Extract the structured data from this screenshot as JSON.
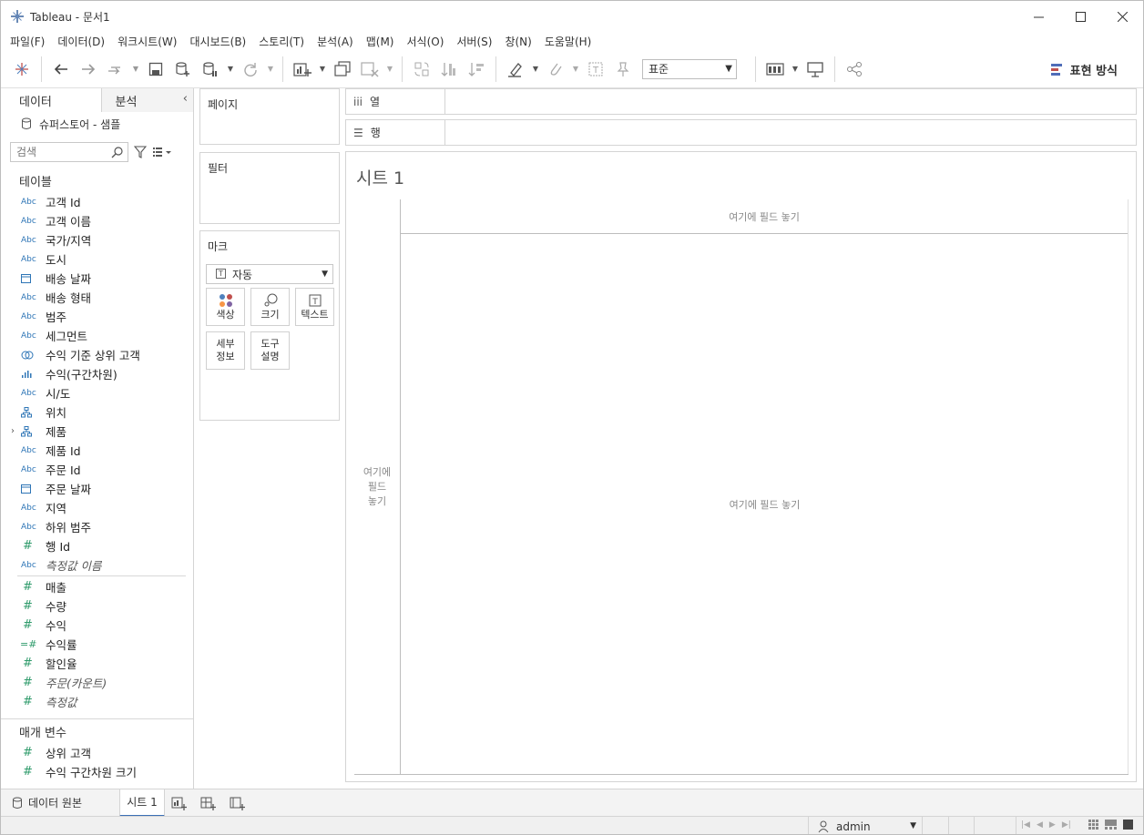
{
  "window": {
    "title": "Tableau - 문서1"
  },
  "menu": [
    "파일(F)",
    "데이터(D)",
    "워크시트(W)",
    "대시보드(B)",
    "스토리(T)",
    "분석(A)",
    "맵(M)",
    "서식(O)",
    "서버(S)",
    "창(N)",
    "도움말(H)"
  ],
  "toolbar": {
    "fit_select": "표준",
    "show_me_label": "표현 방식"
  },
  "data_pane": {
    "tab_data": "데이터",
    "tab_analytics": "분석",
    "datasource": "슈퍼스토어 - 샘플",
    "search_placeholder": "검색",
    "tables_title": "테이블",
    "dimensions": [
      {
        "icon": "Abc",
        "name": "고객 Id"
      },
      {
        "icon": "Abc",
        "name": "고객 이름"
      },
      {
        "icon": "Abc",
        "name": "국가/지역"
      },
      {
        "icon": "Abc",
        "name": "도시"
      },
      {
        "icon": "date",
        "name": "배송 날짜"
      },
      {
        "icon": "Abc",
        "name": "배송 형태"
      },
      {
        "icon": "Abc",
        "name": "범주"
      },
      {
        "icon": "Abc",
        "name": "세그먼트"
      },
      {
        "icon": "set",
        "name": "수익 기준 상위 고객"
      },
      {
        "icon": "bin",
        "name": "수익(구간차원)"
      },
      {
        "icon": "Abc",
        "name": "시/도"
      },
      {
        "icon": "hierarchy",
        "name": "위치"
      },
      {
        "icon": "hierarchy",
        "name": "제품",
        "expandable": true
      },
      {
        "icon": "Abc",
        "name": "제품 Id"
      },
      {
        "icon": "Abc",
        "name": "주문 Id"
      },
      {
        "icon": "date",
        "name": "주문 날짜"
      },
      {
        "icon": "Abc",
        "name": "지역"
      },
      {
        "icon": "Abc",
        "name": "하위 범주"
      },
      {
        "icon": "#",
        "name": "행 Id"
      },
      {
        "icon": "Abc",
        "name": "측정값 이름",
        "italic": true
      }
    ],
    "measures": [
      {
        "icon": "#",
        "name": "매출"
      },
      {
        "icon": "#",
        "name": "수량"
      },
      {
        "icon": "#",
        "name": "수익"
      },
      {
        "icon": "=#",
        "name": "수익률"
      },
      {
        "icon": "#",
        "name": "할인율"
      },
      {
        "icon": "#",
        "name": "주문(카운트)",
        "italic": true
      },
      {
        "icon": "#",
        "name": "측정값",
        "italic": true
      }
    ],
    "parameters_title": "매개 변수",
    "parameters": [
      {
        "icon": "#",
        "name": "상위 고객"
      },
      {
        "icon": "#",
        "name": "수익 구간차원 크기"
      }
    ]
  },
  "shelves": {
    "pages": "페이지",
    "filters": "필터",
    "marks": "마크",
    "marks_type": "자동",
    "mark_color": "색상",
    "mark_size": "크기",
    "mark_text": "텍스트",
    "mark_detail_1": "세부",
    "mark_detail_2": "정보",
    "mark_tooltip_1": "도구",
    "mark_tooltip_2": "설명",
    "columns": "열",
    "rows": "행"
  },
  "view": {
    "sheet_title": "시트 1",
    "drop_top": "여기에 필드 놓기",
    "drop_left_1": "여기에",
    "drop_left_2": "필드",
    "drop_left_3": "놓기",
    "drop_body": "여기에 필드 놓기"
  },
  "tabs": {
    "datasource_tab": "데이터 원본",
    "sheet_tab": "시트 1"
  },
  "status": {
    "user": "admin"
  },
  "colors": {
    "dimension_blue": "#2e75b6",
    "measure_green": "#2f9b6b",
    "active_tab_underline": "#3b6fb6"
  }
}
